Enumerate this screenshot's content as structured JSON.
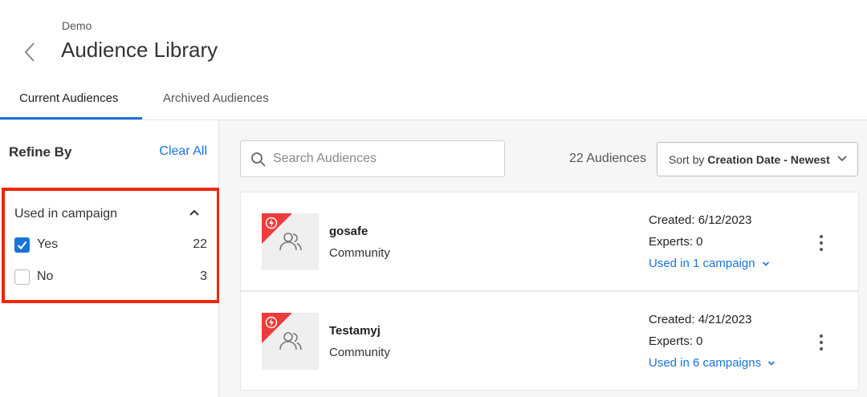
{
  "header": {
    "breadcrumb": "Demo",
    "title": "Audience Library",
    "back_icon": "chevron-left-icon"
  },
  "tabs": [
    {
      "label": "Current Audiences",
      "active": true
    },
    {
      "label": "Archived Audiences",
      "active": false
    }
  ],
  "sidebar": {
    "title": "Refine By",
    "clear_all": "Clear All",
    "filter": {
      "heading": "Used in campaign",
      "expanded": true,
      "options": [
        {
          "label": "Yes",
          "count": "22",
          "checked": true
        },
        {
          "label": "No",
          "count": "3",
          "checked": false
        }
      ]
    }
  },
  "toolbar": {
    "search_placeholder": "Search Audiences",
    "audience_count": "22 Audiences",
    "sort_prefix": "Sort by",
    "sort_value": "Creation Date - Newest"
  },
  "audiences": [
    {
      "name": "gosafe",
      "type": "Community",
      "created": "Created: 6/12/2023",
      "experts": "Experts: 0",
      "campaigns": "Used in 1 campaign"
    },
    {
      "name": "Testamyj",
      "type": "Community",
      "created": "Created: 4/21/2023",
      "experts": "Experts: 0",
      "campaigns": "Used in 6 campaigns"
    }
  ],
  "colors": {
    "accent": "#1a73d9",
    "highlight_border": "#f0260a",
    "flag": "#ef3b3b"
  }
}
